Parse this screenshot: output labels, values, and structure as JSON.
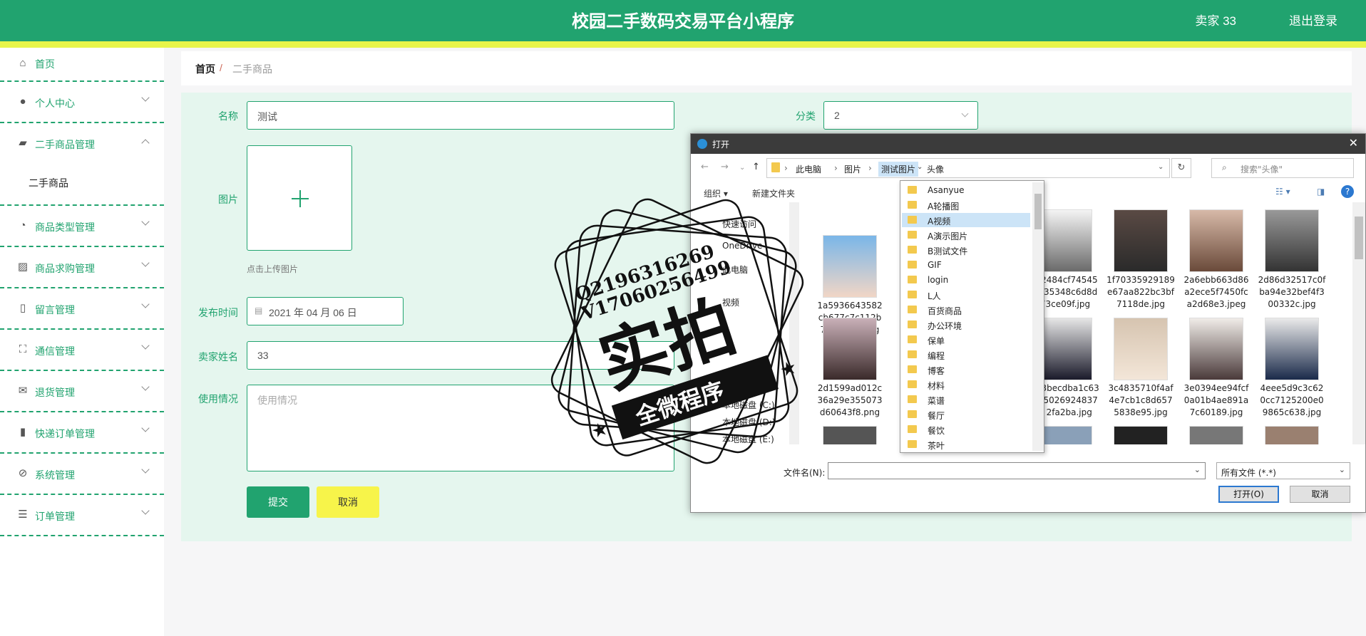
{
  "header": {
    "title": "校园二手数码交易平台小程序",
    "user": "卖家 33",
    "logout": "退出登录"
  },
  "sidebar": {
    "items": [
      {
        "label": "首页",
        "icon": "home-icon"
      },
      {
        "label": "个人中心",
        "icon": "user-icon"
      },
      {
        "label": "二手商品管理",
        "icon": "goods-icon"
      },
      {
        "label": "商品类型管理",
        "icon": "category-icon"
      },
      {
        "label": "商品求购管理",
        "icon": "chart-icon"
      },
      {
        "label": "留言管理",
        "icon": "message-icon"
      },
      {
        "label": "通信管理",
        "icon": "fullscreen-icon"
      },
      {
        "label": "退货管理",
        "icon": "mail-icon"
      },
      {
        "label": "快递订单管理",
        "icon": "bar-chart-icon"
      },
      {
        "label": "系统管理",
        "icon": "bell-off-icon"
      },
      {
        "label": "订单管理",
        "icon": "list-icon"
      }
    ],
    "sub_item": "二手商品"
  },
  "breadcrumb": {
    "home": "首页",
    "sep": "/",
    "current": "二手商品"
  },
  "form": {
    "name_label": "名称",
    "name_value": "测试",
    "category_label": "分类",
    "category_value": "2",
    "image_label": "图片",
    "upload_hint": "点击上传图片",
    "date_label": "发布时间",
    "date_value": "2021 年 04 月 06 日",
    "seller_label": "卖家姓名",
    "seller_value": "33",
    "usage_label": "使用情况",
    "usage_placeholder": "使用情况",
    "submit": "提交",
    "cancel": "取消"
  },
  "dialog": {
    "title": "打开",
    "path": [
      "此电脑",
      "图片",
      "测试图片",
      "头像"
    ],
    "search_placeholder": "搜索\"头像\"",
    "organize": "组织 ▾",
    "new_folder": "新建文件夹",
    "tree": [
      "快速访问",
      "OneDrive",
      "此电脑",
      "视频",
      "本地磁盘 (C:)",
      "本地磁盘 (D:)",
      "本地磁盘 (E:)"
    ],
    "files": [
      "1a5936643582cb677c7c112b78b3a49a.jpg",
      "1f2484cf745454635348c6d8d73ce09f.jpg",
      "1f70335929189e67aa822bc3bf7118de.jpg",
      "2a6ebb663d86a2ece5f7450fca2d68e3.jpeg",
      "2d86d32517c0fba94e32bef4f300332c.jpg",
      "2d1599ad012c36a29e355073d60643f8.png",
      "3c3becdba1c636950269248371 2fa2ba.jpg",
      "3c4835710f4af4e7cb1c8d6575838e95.jpg",
      "3e0394ee94fcf0a01b4ae891a7c60189.jpg",
      "4eee5d9c3c620cc7125200e09865c638.jpg"
    ],
    "filename_label": "文件名(N):",
    "filetype": "所有文件 (*.*)",
    "open": "打开(O)",
    "cancel": "取消"
  },
  "dropdown": {
    "items": [
      "Asanyue",
      "A轮播图",
      "A视频",
      "A演示图片",
      "B测试文件",
      "GIF",
      "login",
      "L人",
      "百货商品",
      "办公环境",
      "保单",
      "编程",
      "博客",
      "材料",
      "菜谱",
      "餐厅",
      "餐饮",
      "茶叶"
    ],
    "highlighted": "A视频"
  },
  "watermark": {
    "line1": "Q2196316269",
    "line2": "V17060256499",
    "main": "实拍",
    "banner": "全微程序"
  },
  "colors": {
    "primary": "#21a36f",
    "accent": "#e8f54a",
    "panel": "#e5f6ee"
  }
}
